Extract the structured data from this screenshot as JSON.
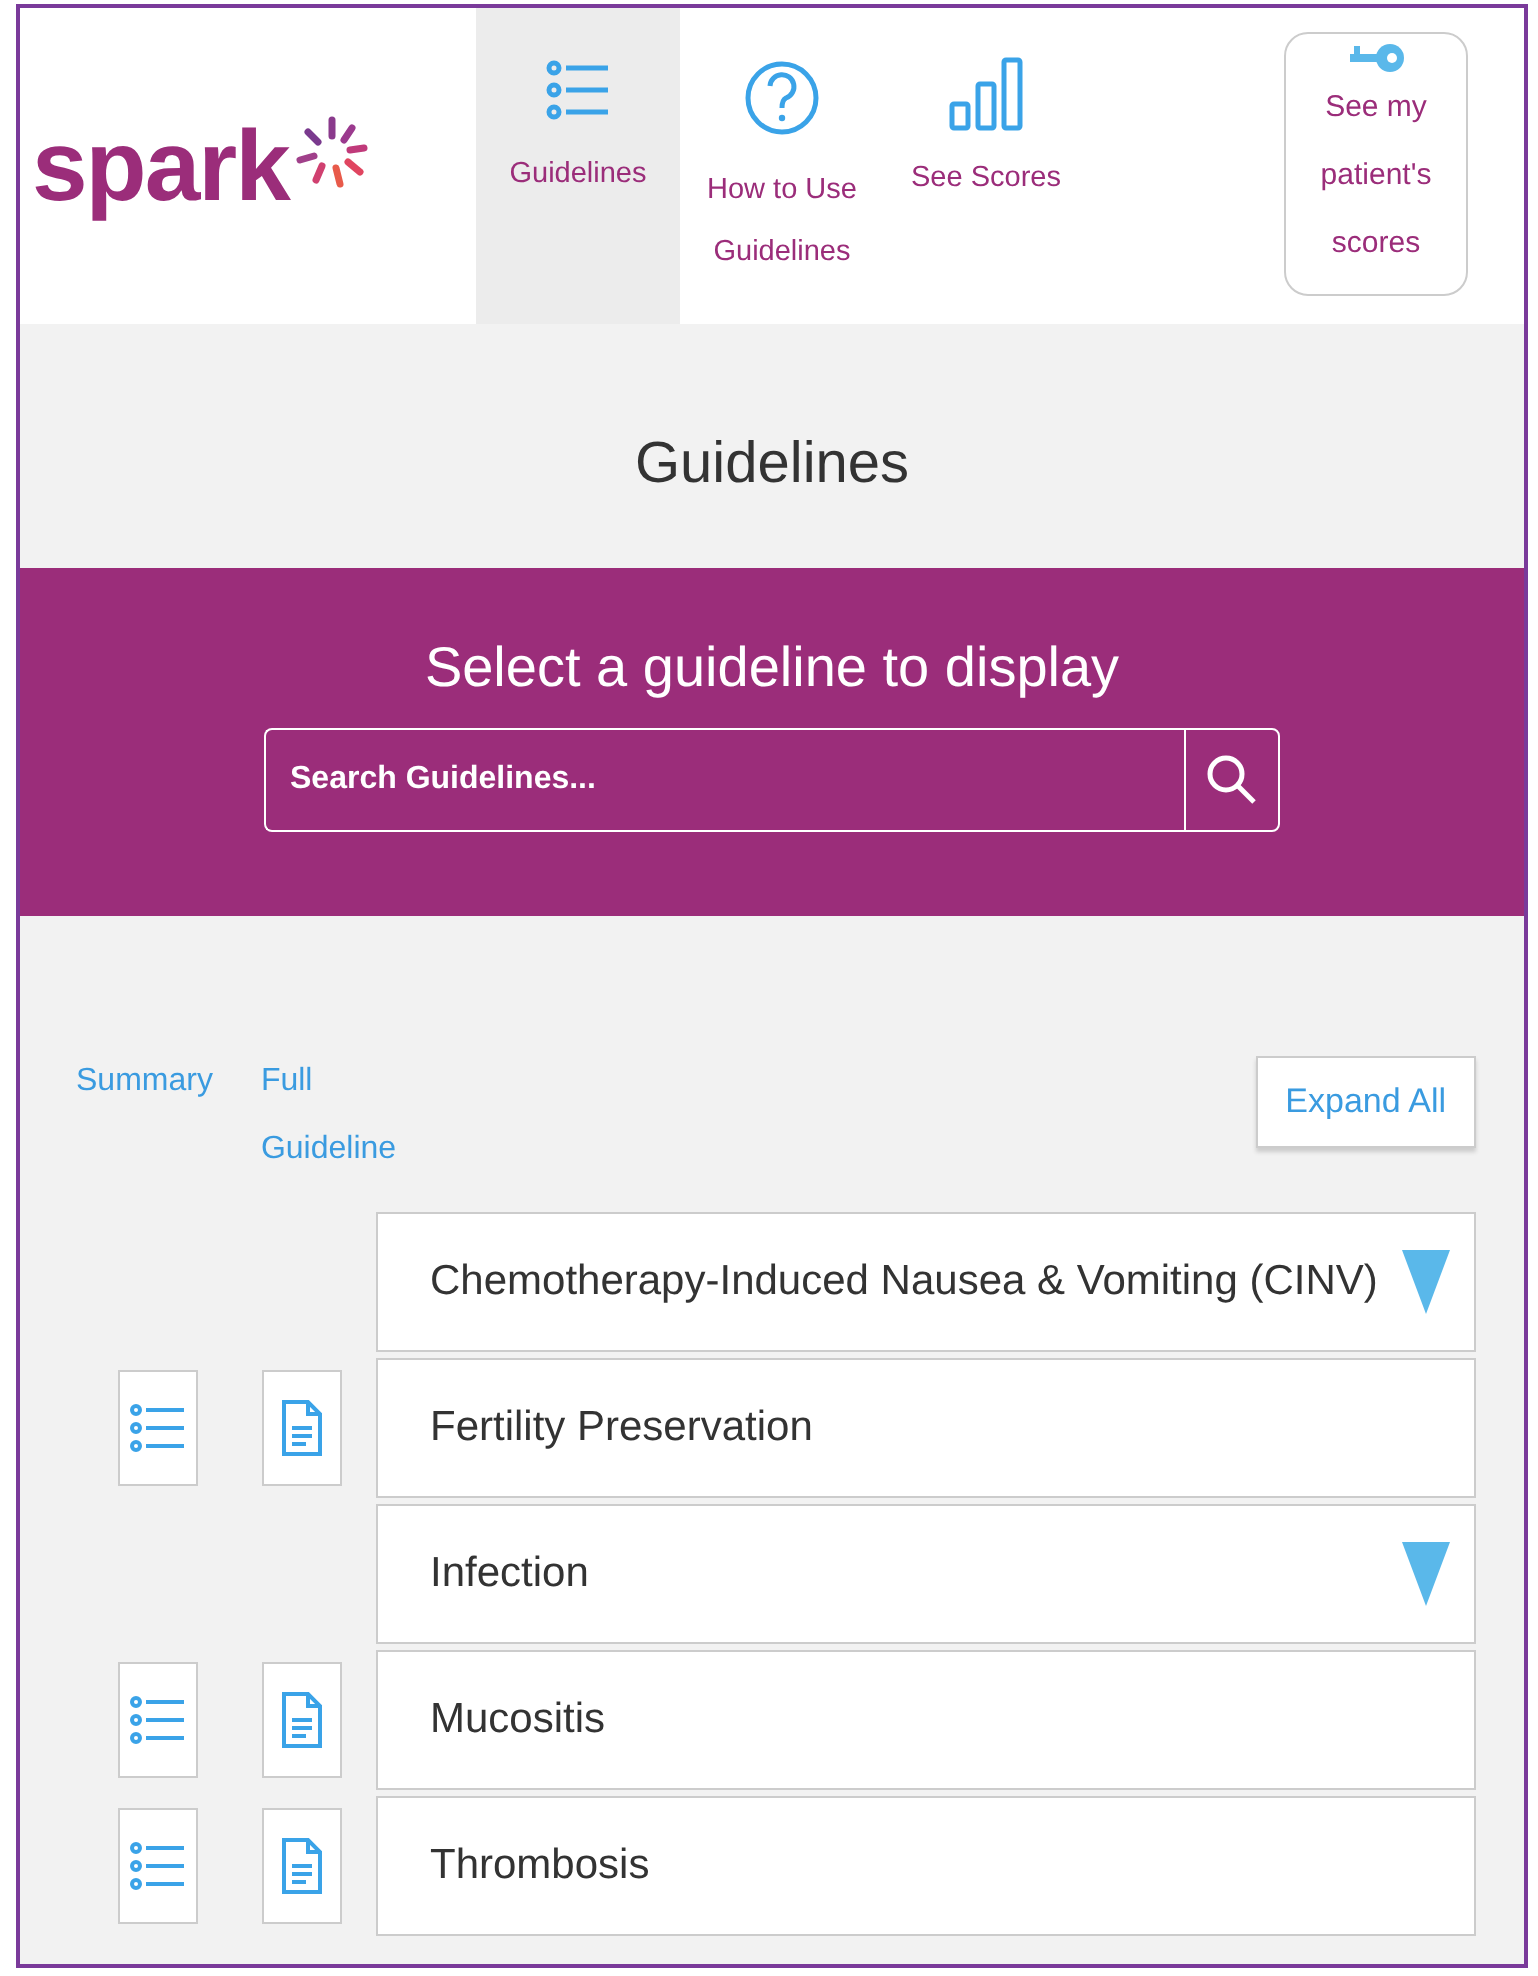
{
  "logo": {
    "text": "spark"
  },
  "nav": [
    {
      "label": "Guidelines",
      "kind": "list",
      "selected": true
    },
    {
      "label": "How to Use Guidelines",
      "kind": "help",
      "selected": false
    },
    {
      "label": "See Scores",
      "kind": "bars",
      "selected": false
    }
  ],
  "patient_button": {
    "label": "See my patient's scores"
  },
  "page_title": "Guidelines",
  "banner": {
    "heading": "Select a guideline to display",
    "search": {
      "placeholder": "Search Guidelines..."
    }
  },
  "columns": {
    "summary": "Summary",
    "full": "Full Guideline"
  },
  "expand_all": "Expand All",
  "guidelines": [
    {
      "title": "Chemotherapy-Induced Nausea & Vomiting (CINV)",
      "kind": "category"
    },
    {
      "title": "Fertility Preservation",
      "kind": "guideline"
    },
    {
      "title": "Infection",
      "kind": "category"
    },
    {
      "title": "Mucositis",
      "kind": "guideline"
    },
    {
      "title": "Thrombosis",
      "kind": "guideline"
    }
  ]
}
